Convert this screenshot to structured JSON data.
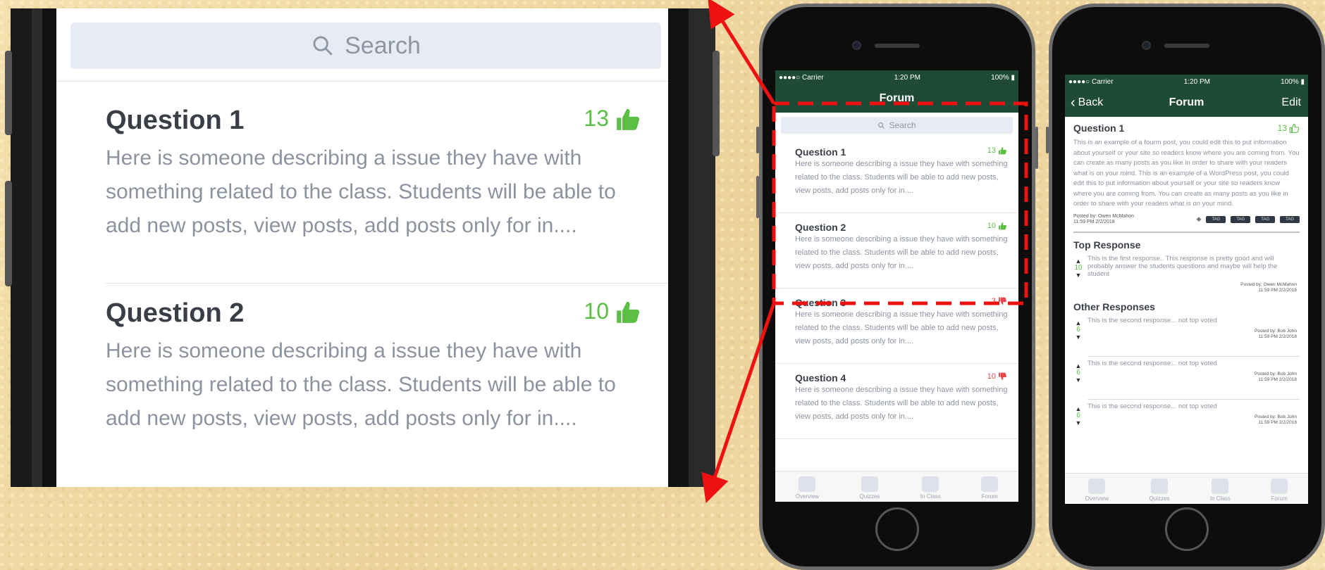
{
  "zoom": {
    "search_placeholder": "Search",
    "questions": [
      {
        "title": "Question 1",
        "votes": "13",
        "body": "Here is someone describing a issue they have with something related to the class. Students will be able to add new posts, view posts, add posts only for in...."
      },
      {
        "title": "Question 2",
        "votes": "10",
        "body": "Here is someone describing a issue they have with something related to the class. Students will be able to add new posts, view posts, add posts only for in...."
      }
    ]
  },
  "phone_list": {
    "status": {
      "carrier": "●●●●○ Carrier",
      "time": "1:20 PM",
      "battery": "100%"
    },
    "nav_title": "Forum",
    "search_placeholder": "Search",
    "questions": [
      {
        "title": "Question 1",
        "votes": "13",
        "vote_type": "up",
        "body": "Here is someone describing a issue they have with something related to the class. Students will be able to add new posts, view posts, add posts only for in...."
      },
      {
        "title": "Question 2",
        "votes": "10",
        "vote_type": "up",
        "body": "Here is someone describing a issue they have with something related to the class. Students will be able to add new posts, view posts, add posts only for in...."
      },
      {
        "title": "Question 3",
        "votes": "3",
        "vote_type": "down",
        "body": "Here is someone describing a issue they have with something related to the class. Students will be able to add new posts, view posts, add posts only for in...."
      },
      {
        "title": "Question 4",
        "votes": "10",
        "vote_type": "down",
        "body": "Here is someone describing a issue they have with something related to the class. Students will be able to add new posts, view posts, add posts only for in...."
      }
    ],
    "tabs": [
      "Overview",
      "Quizzes",
      "In Class",
      "Forum"
    ]
  },
  "phone_detail": {
    "status": {
      "carrier": "●●●●○ Carrier",
      "time": "1:20 PM",
      "battery": "100%"
    },
    "back_label": "Back",
    "nav_title": "Forum",
    "edit_label": "Edit",
    "question": {
      "title": "Question 1",
      "votes": "13",
      "body": "This is an example of a fourm post, you could edit this to put information about yourself or your site so readers know where you are coming from. You can create as many posts as you like in order to share with your readers what is on your mind. This is an example of a WordPress post, you could edit this to put information about yourself or your site so readers know where you are coming from. You can create as many posts as you like in order to share with your readers what is on your mind.",
      "posted_by": "Posted by: Owen McMahon",
      "posted_at": "11:59 PM 2/2/2018",
      "tags": [
        "TAG",
        "TAG",
        "TAG",
        "TAG"
      ]
    },
    "top_response_heading": "Top Response",
    "top_response": {
      "votes": "10",
      "text": "This is the first response.. This response is pretty good and will probably answer the students questions and maybe will help the student",
      "posted_by": "Posted by: Owen McMahon",
      "posted_at": "11:59 PM 2/2/2018"
    },
    "other_responses_heading": "Other Responses",
    "other_responses": [
      {
        "votes": "6",
        "text": "This is the second response... not top voted",
        "posted_by": "Posted by: Bob John",
        "posted_at": "11:59 PM 2/2/2018"
      },
      {
        "votes": "6",
        "text": "This is the second response... not top voted",
        "posted_by": "Posted by: Bob John",
        "posted_at": "11:59 PM 2/2/2018"
      },
      {
        "votes": "6",
        "text": "This is the second response... not top voted",
        "posted_by": "Posted by: Bob John",
        "posted_at": "11:59 PM 2/2/2018"
      }
    ],
    "tabs": [
      "Overview",
      "Quizzes",
      "In Class",
      "Forum"
    ]
  },
  "colors": {
    "nav_green": "#1e4a36",
    "vote_up": "#5cbf45",
    "vote_down": "#e8464b",
    "annotation_red": "#ee1111"
  }
}
